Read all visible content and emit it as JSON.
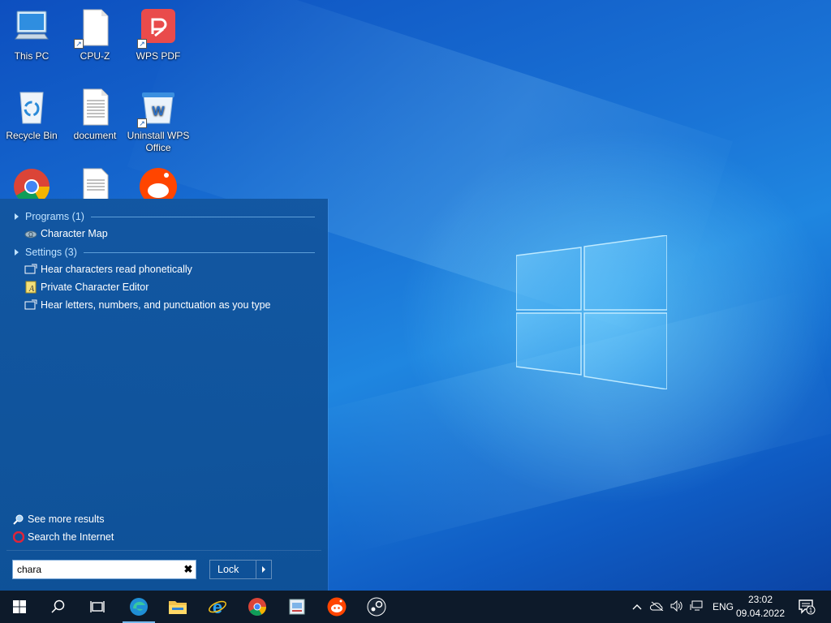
{
  "desktop": {
    "icons": [
      {
        "label": "This PC"
      },
      {
        "label": "CPU-Z"
      },
      {
        "label": "WPS PDF"
      },
      {
        "label": "Recycle Bin"
      },
      {
        "label": "document"
      },
      {
        "label": "Uninstall WPS Office"
      }
    ]
  },
  "start_menu": {
    "programs_header": "Programs (1)",
    "programs": [
      {
        "label": "Character Map",
        "icon": "character-map-icon"
      }
    ],
    "settings_header": "Settings (3)",
    "settings": [
      {
        "label": "Hear characters read phonetically",
        "icon": "narrator-settings-icon"
      },
      {
        "label": "Private Character Editor",
        "icon": "private-character-editor-icon"
      },
      {
        "label": "Hear letters, numbers, and punctuation as you type",
        "icon": "narrator-settings-icon"
      }
    ],
    "see_more": "See more results",
    "search_internet": "Search the Internet",
    "search": {
      "value": "chara",
      "placeholder": ""
    },
    "lock_label": "Lock"
  },
  "taskbar": {
    "apps": [
      "start",
      "search",
      "task-view",
      "edge",
      "file-explorer",
      "internet-explorer",
      "chrome",
      "wordpad",
      "reddit",
      "steam"
    ],
    "language": "ENG",
    "time": "23:02",
    "date": "09.04.2022",
    "notification_count": "1"
  },
  "colors": {
    "accent": "#76b9ed",
    "taskbar": "#0d1a2a",
    "start_menu": "#1256a0"
  }
}
